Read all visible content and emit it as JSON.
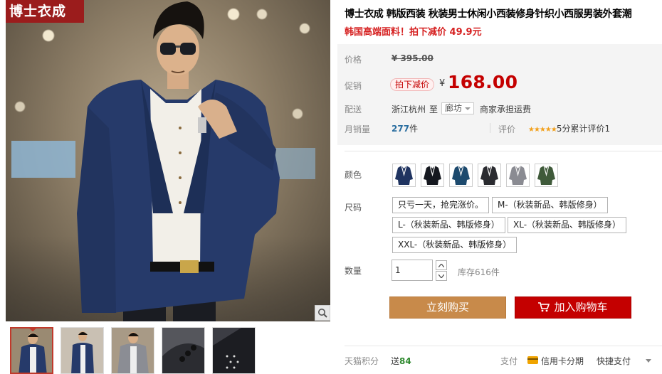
{
  "gallery": {
    "brand_badge": "博士衣成",
    "thumbnail_count": 5,
    "selected_thumbnail": 0
  },
  "product": {
    "title": "博士衣成 韩版西装 秋装男士休闲小西装修身针织小西服男装外套潮",
    "subtitle": "韩国高端面料！拍下减价 49.9元"
  },
  "price": {
    "label": "价格",
    "original": "¥ 395.00",
    "promo_label": "促销",
    "promo_tag": "拍下减价",
    "currency": "¥",
    "current": "168.00"
  },
  "shipping": {
    "label": "配送",
    "from": "浙江杭州",
    "to_word": "至",
    "destination": "廊坊",
    "note": "商家承担运费"
  },
  "stats": {
    "sales_label": "月销量",
    "sales_value": "277",
    "sales_unit": "件",
    "rating_label": "评价",
    "rating_stars": "★★★★★",
    "rating_text": "5分累计评价1",
    "rating_score": 5
  },
  "options": {
    "color_label": "颜色",
    "swatch_colors": [
      "#1f3360",
      "#15181f",
      "#1d4a6e",
      "#2a2b30",
      "#8a8b92",
      "#3f5a3a"
    ],
    "size_label": "尺码",
    "sizes": [
      "只亏一天，抢完涨价。",
      "M-（秋装新品、韩版修身）",
      "L-（秋装新品、韩版修身）",
      "XL-（秋装新品、韩版修身）",
      "XXL-（秋装新品、韩版修身）"
    ],
    "qty_label": "数量",
    "qty_value": "1",
    "stock_text": "库存616件"
  },
  "actions": {
    "buy_now": "立刻购买",
    "add_to_cart": "加入购物车"
  },
  "footer": {
    "points_label": "天猫积分",
    "points_prefix": "送",
    "points_value": "84",
    "pay_label": "支付",
    "card_installment": "信用卡分期",
    "quick_pay": "快捷支付"
  },
  "colors": {
    "accent_red": "#c40000",
    "buy_now_orange": "#c88a4a",
    "brand_badge_red": "#9b1c1c",
    "star_orange": "#f2a01b"
  }
}
